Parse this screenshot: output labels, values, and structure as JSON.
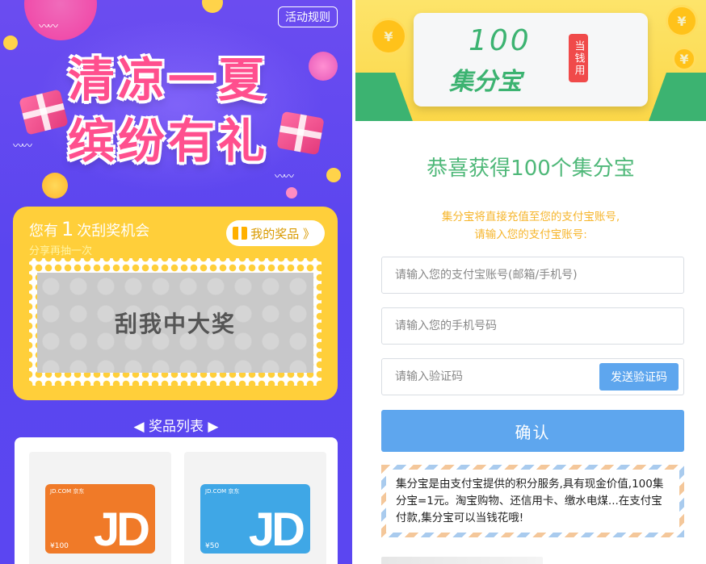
{
  "left": {
    "rules_button": "活动规则",
    "hero_line1": "清凉一夏",
    "hero_line2": "缤纷有礼",
    "chance_prefix": "您有",
    "chance_count": "1",
    "chance_suffix": "次刮奖机会",
    "share_text": "分享再抽一次",
    "my_prizes": "我的奖品 》",
    "scratch_text": "刮我中大奖",
    "prize_list_title": "◀ 奖品列表 ▶",
    "prizes": [
      {
        "brand": "JD.COM 京东",
        "logo": "JD",
        "amount": "¥100",
        "color": "#f07a28"
      },
      {
        "brand": "JD.COM 京东",
        "logo": "JD",
        "amount": "¥50",
        "color": "#3fa7e6"
      }
    ]
  },
  "right": {
    "brand_number": "100",
    "brand_name": "集分宝",
    "brand_tag": "当钱用",
    "congrats": "恭喜获得100个集分宝",
    "hint_line1": "集分宝将直接充值至您的支付宝账号,",
    "hint_line2": "请输入您的支付宝账号:",
    "account_placeholder": "请输入您的支付宝账号(邮箱/手机号)",
    "phone_placeholder": "请输入您的手机号码",
    "code_placeholder": "请输入验证码",
    "send_code": "发送验证码",
    "confirm": "确认",
    "info_text": "集分宝是由支付宝提供的积分服务,具有现金价值,100集分宝=1元。淘宝购物、还信用卡、缴水电煤...在支付宝付款,集分宝可以当钱花哦!"
  },
  "colors": {
    "left_bg": "#5a45ef",
    "card_yellow": "#ffcf3a",
    "hero_pink": "#ff4f8e",
    "green": "#4fb879",
    "accent_blue": "#5ea6ee",
    "hint_orange": "#f6b52b"
  }
}
